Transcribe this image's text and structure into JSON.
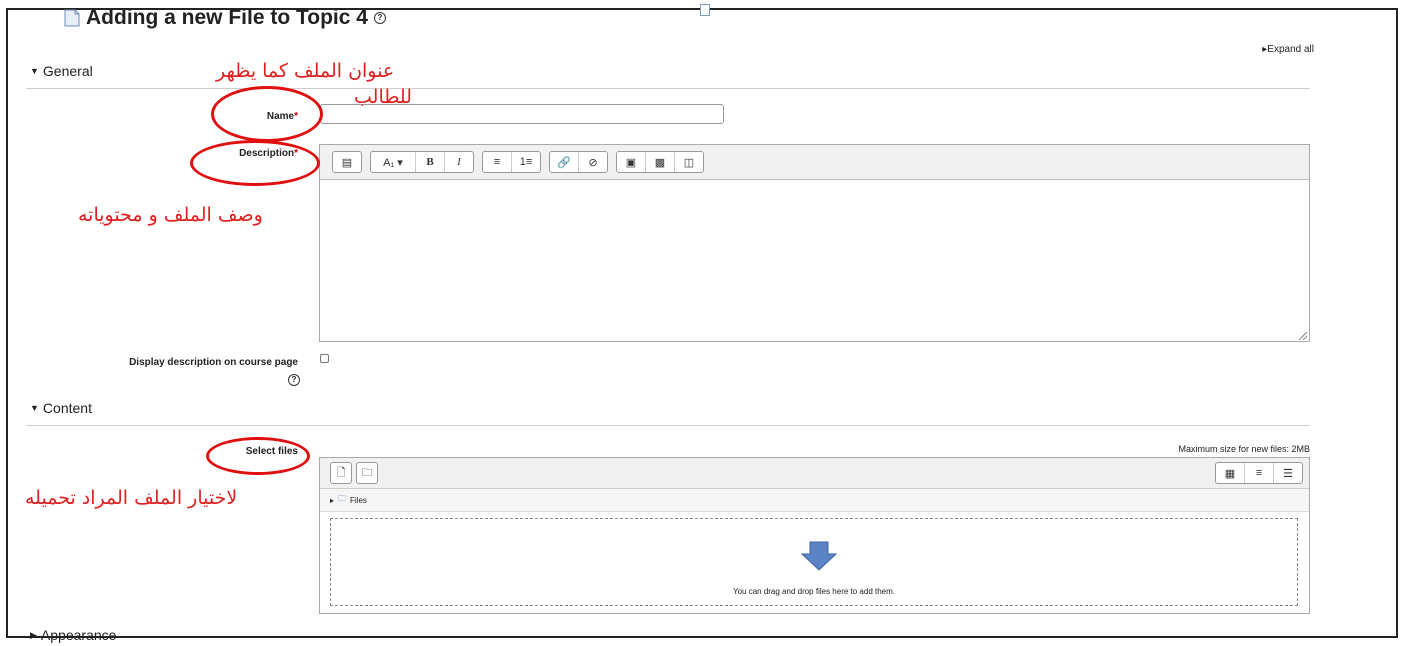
{
  "page": {
    "title": "Adding a new File to Topic 4",
    "expand_all": "Expand all"
  },
  "sections": {
    "general": "General",
    "content": "Content",
    "appearance": "Appearance"
  },
  "fields": {
    "name_label": "Name",
    "name_value": "",
    "description_label": "Description",
    "display_description_label": "Display description on course page",
    "display_description_checked": false,
    "select_files_label": "Select files",
    "required_mark": "*"
  },
  "editor_toolbar": [
    [
      "collapse-icon"
    ],
    [
      "font-style-icon",
      "bold-icon",
      "italic-icon"
    ],
    [
      "unordered-list-icon",
      "ordered-list-icon"
    ],
    [
      "link-icon",
      "unlink-icon"
    ],
    [
      "image-icon",
      "media-icon",
      "manage-files-icon"
    ]
  ],
  "filepicker": {
    "max_size": "Maximum size for new files: 2MB",
    "path_label": "Files",
    "drop_text": "You can drag and drop files here to add them.",
    "buttons": [
      "add-file-icon",
      "create-folder-icon"
    ],
    "views": [
      "icon-view-icon",
      "list-view-icon",
      "tree-view-icon"
    ]
  },
  "annotations": {
    "name_note_line1": "عنوان الملف كما يظهر",
    "name_note_line2": "للطالب",
    "description_note": "وصف الملف و محتوياته",
    "files_note": "لاختيار الملف المراد تحميله",
    "color": "#e02020"
  }
}
